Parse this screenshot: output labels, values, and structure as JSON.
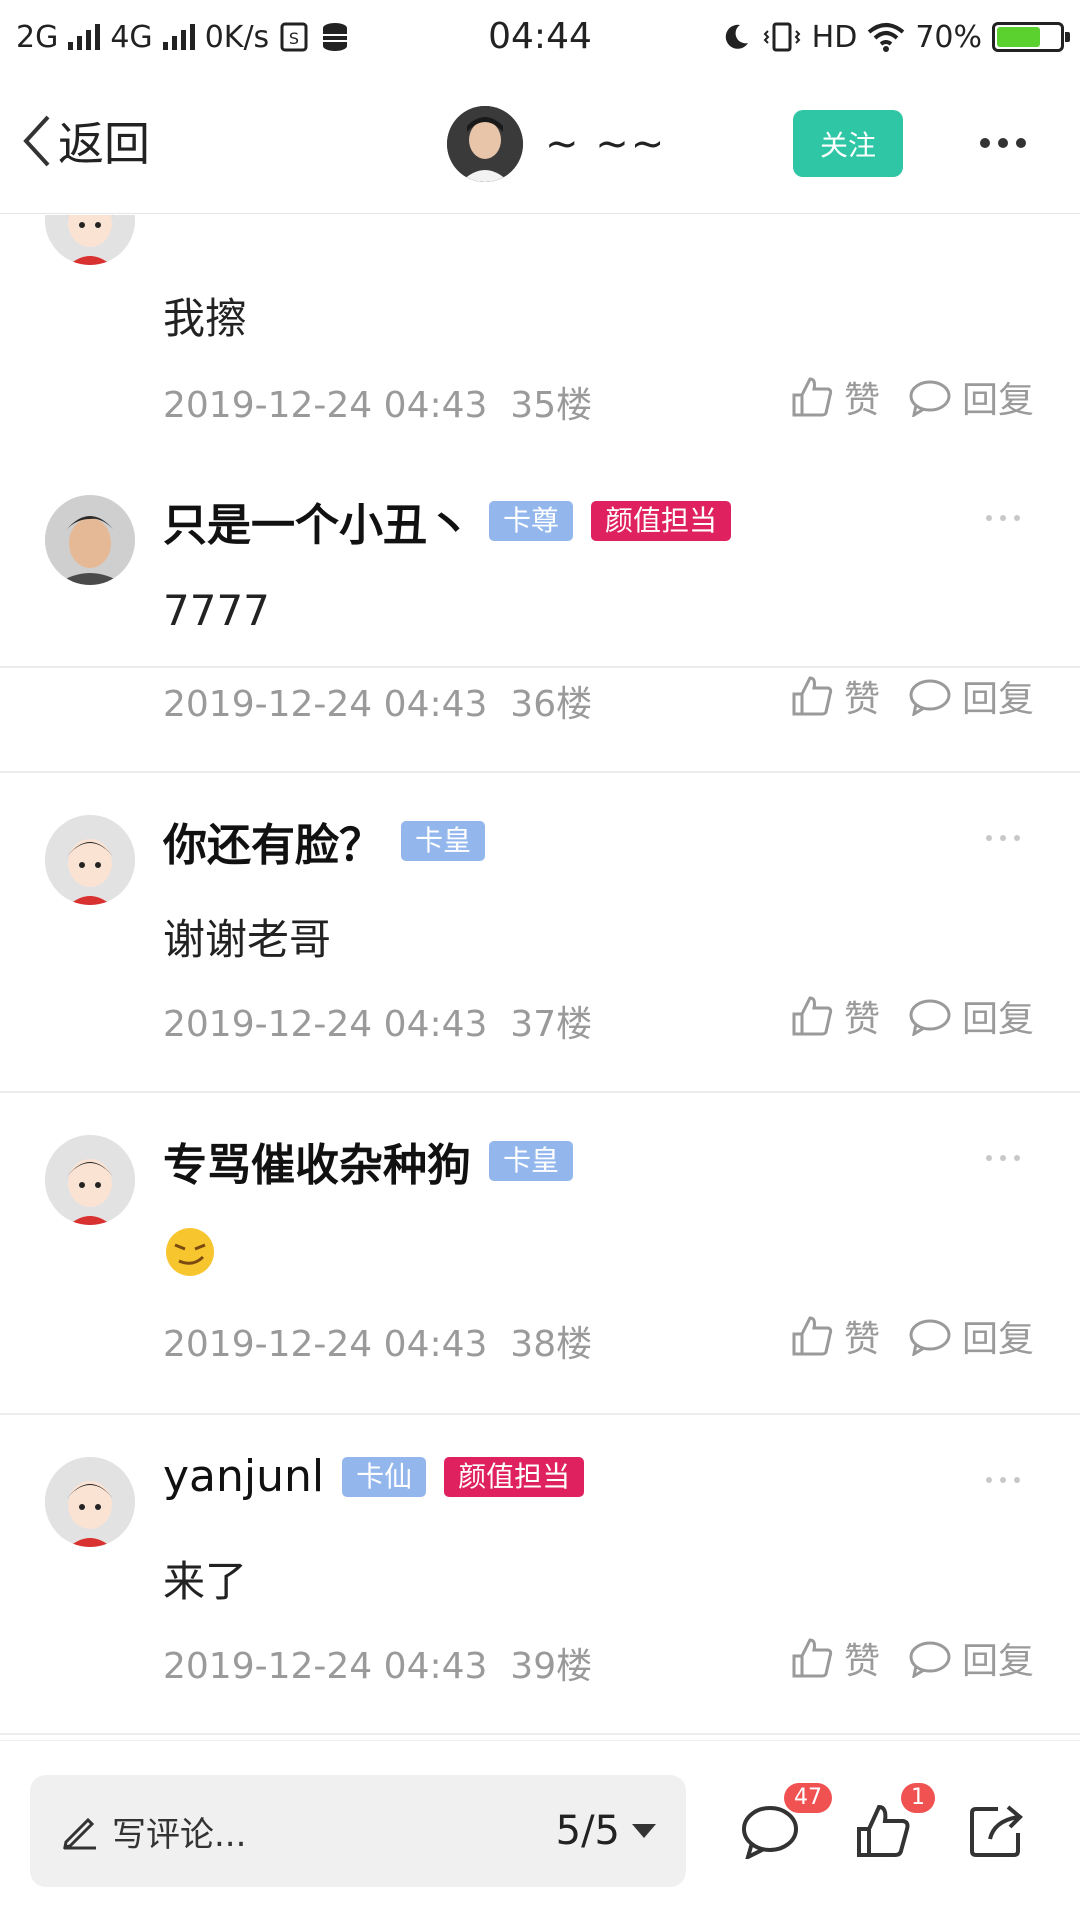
{
  "status_bar": {
    "network_1": "2G",
    "network_2": "4G",
    "speed": "0K/s",
    "time": "04:44",
    "hd": "HD",
    "battery": "70%",
    "battery_level": 0.7
  },
  "nav": {
    "back_label": "返回",
    "title_name": "~ ~~",
    "follow_label": "关注"
  },
  "comments": [
    {
      "username": "",
      "badges": [],
      "text": "我擦",
      "timestamp": "2019-12-24 04:43",
      "floor": "35楼",
      "like_label": "赞",
      "reply_label": "回复"
    },
    {
      "username": "只是一个小丑丶",
      "badges": [
        {
          "label": "卡尊",
          "color": "blue"
        },
        {
          "label": "颜值担当",
          "color": "red"
        }
      ],
      "text": "7777",
      "timestamp": "2019-12-24 04:43",
      "floor": "36楼",
      "like_label": "赞",
      "reply_label": "回复"
    },
    {
      "username": "你还有脸？",
      "badges": [
        {
          "label": "卡皇",
          "color": "blue"
        }
      ],
      "text": "谢谢老哥",
      "timestamp": "2019-12-24 04:43",
      "floor": "37楼",
      "like_label": "赞",
      "reply_label": "回复"
    },
    {
      "username": "专骂催收杂种狗",
      "badges": [
        {
          "label": "卡皇",
          "color": "blue"
        }
      ],
      "text": "",
      "timestamp": "2019-12-24 04:43",
      "floor": "38楼",
      "like_label": "赞",
      "reply_label": "回复"
    },
    {
      "username": "yanjunl",
      "badges": [
        {
          "label": "卡仙",
          "color": "blue"
        },
        {
          "label": "颜值担当",
          "color": "red"
        }
      ],
      "text": "来了",
      "timestamp": "2019-12-24 04:43",
      "floor": "39楼",
      "like_label": "赞",
      "reply_label": "回复"
    }
  ],
  "bottom_bar": {
    "input_placeholder": "写评论...",
    "page_indicator": "5/5",
    "comment_count": "47",
    "like_count": "1"
  },
  "colors": {
    "follow_button": "#2ec6a4",
    "badge_blue": "#93b7ec",
    "badge_red": "#e0215f",
    "count_badge": "#f05252"
  }
}
